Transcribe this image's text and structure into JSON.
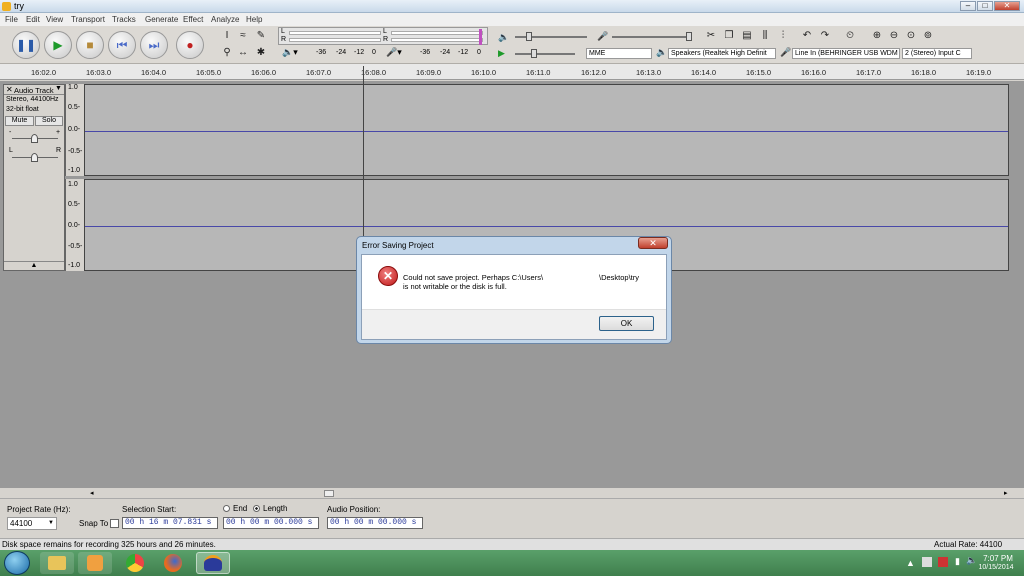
{
  "window": {
    "title": "try"
  },
  "menu": [
    "File",
    "Edit",
    "View",
    "Transport",
    "Tracks",
    "Generate",
    "Effect",
    "Analyze",
    "Help"
  ],
  "meters": {
    "left_letters": [
      "L",
      "R"
    ],
    "scale_ticks_a": [
      "-36",
      "-24",
      "-12",
      "0"
    ],
    "scale_ticks_b": [
      "-36",
      "-24",
      "-12",
      "0"
    ]
  },
  "devices": {
    "host": "MME",
    "playback": "Speakers (Realtek High Definit",
    "recording": "Line In (BEHRINGER USB WDM",
    "channels": "2 (Stereo) Input C"
  },
  "ruler": [
    "16:02.0",
    "16:03.0",
    "16:04.0",
    "16:05.0",
    "16:06.0",
    "16:07.0",
    "16:08.0",
    "16:09.0",
    "16:10.0",
    "16:11.0",
    "16:12.0",
    "16:13.0",
    "16:14.0",
    "16:15.0",
    "16:16.0",
    "16:17.0",
    "16:18.0",
    "16:19.0"
  ],
  "track": {
    "name": "Audio Track",
    "info1": "Stereo, 44100Hz",
    "info2": "32-bit float",
    "mute": "Mute",
    "solo": "Solo",
    "gain_minus": "-",
    "gain_plus": "+",
    "pan_l": "L",
    "pan_r": "R"
  },
  "vscale": [
    "1.0",
    "0.5-",
    "0.0-",
    "-0.5-",
    "-1.0"
  ],
  "dialog": {
    "title": "Error Saving Project",
    "message_line1": "Could not save project. Perhaps C:\\Users\\",
    "message_path": "\\Desktop\\try",
    "message_line2": "is not writable or the disk is full.",
    "ok": "OK"
  },
  "bottom": {
    "project_rate_label": "Project Rate (Hz):",
    "project_rate": "44100",
    "snap_label": "Snap To",
    "selection_start_label": "Selection Start:",
    "selection_start": "00 h 16 m 07.831 s",
    "end_label": "End",
    "length_label": "Length",
    "length": "00 h 00 m 00.000 s",
    "audio_position_label": "Audio Position:",
    "audio_position": "00 h 00 m 00.000 s"
  },
  "status": {
    "left": "Disk space remains for recording 325 hours and 26 minutes.",
    "right": "Actual Rate: 44100"
  },
  "taskbar": {
    "time": "7:07 PM",
    "date": "10/15/2014"
  }
}
